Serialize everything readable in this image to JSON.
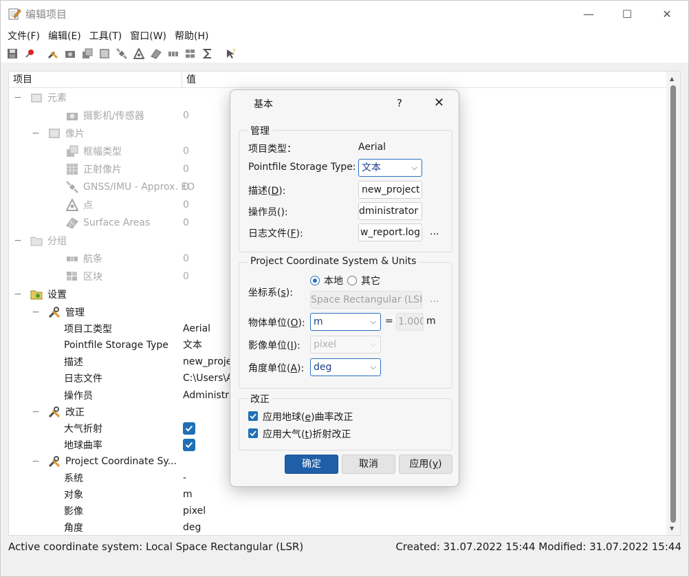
{
  "window": {
    "title": "编辑项目",
    "minimize_glyph": "—",
    "maximize_glyph": "☐",
    "close_glyph": "✕"
  },
  "menu": [
    "文件(F)",
    "编辑(E)",
    "工具(T)",
    "窗口(W)",
    "帮助(H)"
  ],
  "toolbar_icons": [
    "save-icon",
    "pin-icon",
    "tools-icon",
    "camera-icon",
    "frame-icon",
    "image-icon",
    "satellite-icon",
    "point-icon",
    "surface-icon",
    "strip-icon",
    "block-icon",
    "sigma-icon",
    "query-icon"
  ],
  "tree": {
    "header": {
      "col_item": "项目",
      "col_value": "值"
    },
    "rows": [
      {
        "label": "元素",
        "value": "",
        "expander": "−",
        "icon": "elements-icon",
        "disabled": true
      },
      {
        "label": "摄影机/传感器",
        "value": "0",
        "expander": "",
        "icon": "camera-icon",
        "disabled": true
      },
      {
        "label": "像片",
        "value": "",
        "expander": "−",
        "icon": "photo-icon",
        "disabled": true
      },
      {
        "label": "框幅类型",
        "value": "0",
        "expander": "",
        "icon": "frame-icon",
        "disabled": true
      },
      {
        "label": "正射像片",
        "value": "0",
        "expander": "",
        "icon": "ortho-icon",
        "disabled": true
      },
      {
        "label": "GNSS/IMU - Approx. EO",
        "value": "0",
        "expander": "",
        "icon": "satellite-icon",
        "disabled": true
      },
      {
        "label": "点",
        "value": "0",
        "expander": "",
        "icon": "point-icon",
        "disabled": true
      },
      {
        "label": "Surface Areas",
        "value": "0",
        "expander": "",
        "icon": "surface-icon",
        "disabled": true
      },
      {
        "label": "分组",
        "value": "",
        "expander": "−",
        "icon": "folder-icon",
        "disabled": true
      },
      {
        "label": "航条",
        "value": "0",
        "expander": "",
        "icon": "strip-icon",
        "disabled": true
      },
      {
        "label": "区块",
        "value": "0",
        "expander": "",
        "icon": "block-icon",
        "disabled": true
      },
      {
        "label": "设置",
        "value": "",
        "expander": "−",
        "icon": "settings-folder-icon",
        "disabled": false
      },
      {
        "label": "管理",
        "value": "",
        "expander": "−",
        "icon": "tools-icon",
        "disabled": false
      },
      {
        "label": "项目工类型",
        "value": "Aerial",
        "expander": "",
        "icon": "",
        "disabled": false
      },
      {
        "label": "Pointfile Storage Type",
        "value": "文本",
        "expander": "",
        "icon": "",
        "disabled": false
      },
      {
        "label": "描述",
        "value": "new_proje",
        "expander": "",
        "icon": "",
        "disabled": false
      },
      {
        "label": "日志文件",
        "value": "C:\\Users\\A",
        "expander": "",
        "icon": "",
        "disabled": false
      },
      {
        "label": "操作员",
        "value": "Administra",
        "expander": "",
        "icon": "",
        "disabled": false
      },
      {
        "label": "改正",
        "value": "",
        "expander": "−",
        "icon": "tools-icon",
        "disabled": false
      },
      {
        "label": "大气折射",
        "value": "",
        "expander": "",
        "icon": "",
        "disabled": false,
        "checked": true
      },
      {
        "label": "地球曲率",
        "value": "",
        "expander": "",
        "icon": "",
        "disabled": false,
        "checked": true
      },
      {
        "label": "Project Coordinate Sy...",
        "value": "",
        "expander": "−",
        "icon": "tools-icon",
        "disabled": false
      },
      {
        "label": "系统",
        "value": "-",
        "expander": "",
        "icon": "",
        "disabled": false
      },
      {
        "label": "对象",
        "value": "m",
        "expander": "",
        "icon": "",
        "disabled": false
      },
      {
        "label": "影像",
        "value": "pixel",
        "expander": "",
        "icon": "",
        "disabled": false
      },
      {
        "label": "角度",
        "value": "deg",
        "expander": "",
        "icon": "",
        "disabled": false
      }
    ]
  },
  "status": {
    "left": "Active coordinate system: Local Space Rectangular (LSR)",
    "right": "Created: 31.07.2022 15:44  Modified: 31.07.2022 15:44"
  },
  "dialog": {
    "title": "基本",
    "help": "?",
    "close": "✕",
    "admin": {
      "group_title": "管理",
      "project_type_label": "项目类型：",
      "project_type_value": "Aerial",
      "storage_label": "Pointfile Storage Type:",
      "storage_value": "文本",
      "desc_label_pre": "描述(",
      "desc_label_key": "D",
      "desc_label_post": "):",
      "desc_value": "new_project",
      "operator_label_pre": "操作员(",
      "operator_label_key": "",
      "operator_label_post": "):",
      "operator_value": "Administrator",
      "operator_value_visible": "dministrator",
      "log_label_pre": "日志文件(",
      "log_label_key": "F",
      "log_label_post": "):",
      "log_value": "w_report.log",
      "log_browse": "..."
    },
    "coords": {
      "group_title": "Project Coordinate System & Units",
      "cs_label_pre": "坐标系(",
      "cs_label_key": "s",
      "cs_label_post": "):",
      "radio_local": "本地",
      "radio_other": "其它",
      "cs_value": "Space Rectangular (LSR)",
      "cs_browse": "...",
      "object_unit_label_pre": "物体单位(",
      "object_unit_label_key": "O",
      "object_unit_label_post": "):",
      "object_unit_value": "m",
      "equals": "=",
      "factor_value": "1.000",
      "factor_unit": "m",
      "image_unit_label_pre": "影像单位(",
      "image_unit_label_key": "I",
      "image_unit_label_post": "):",
      "image_unit_value": "pixel",
      "angle_unit_label_pre": "角度单位(",
      "angle_unit_label_key": "A",
      "angle_unit_label_post": "):",
      "angle_unit_value": "deg"
    },
    "correction": {
      "group_title": "改正",
      "earth_pre": "应用地球(",
      "earth_key": "e",
      "earth_post": ")曲率改正",
      "atmos_pre": "应用大气(",
      "atmos_key": "t",
      "atmos_post": ")折射改正"
    },
    "buttons": {
      "ok": "确定",
      "cancel": "取消",
      "apply_pre": "应用(",
      "apply_key": "y",
      "apply_post": ")"
    }
  },
  "colors": {
    "accent": "#1f5fa8",
    "checkbox": "#1f6fb5",
    "disabled_text": "#a8a8a8"
  }
}
